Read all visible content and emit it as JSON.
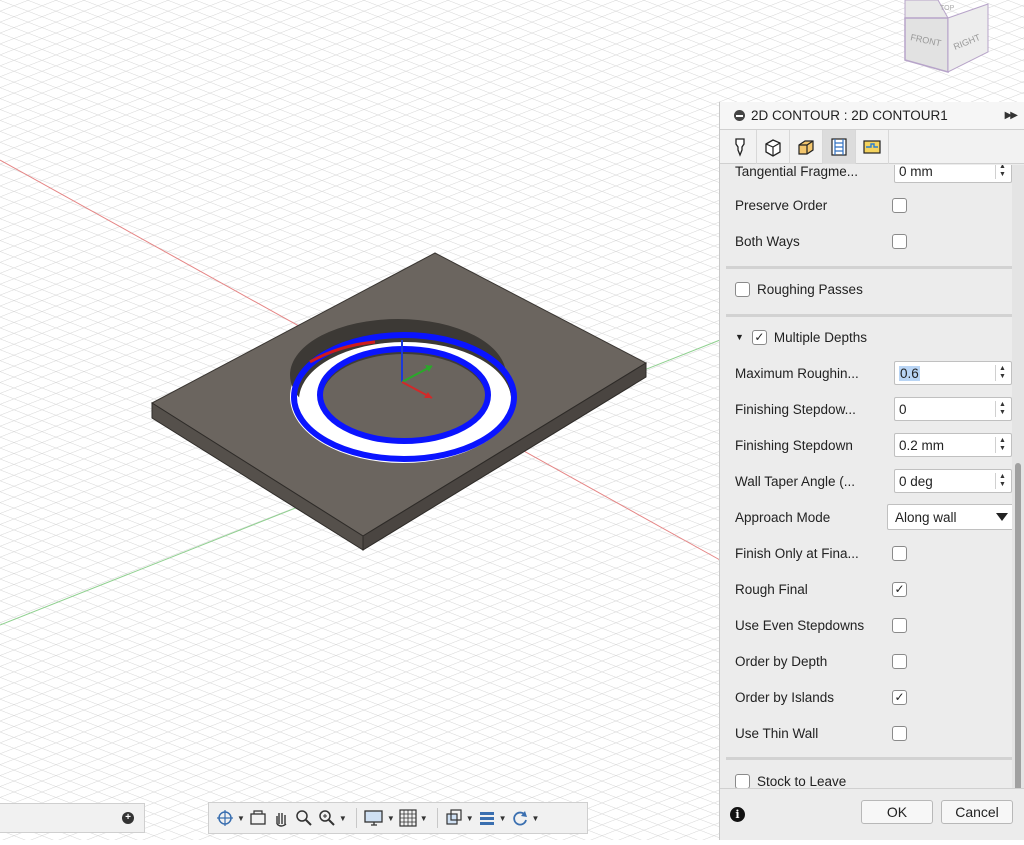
{
  "panel": {
    "title": "2D CONTOUR : 2D CONTOUR1",
    "expand_glyph": "▶▶",
    "tabs": [
      {
        "icon": "tool-icon"
      },
      {
        "icon": "geometry-icon"
      },
      {
        "icon": "heights-icon"
      },
      {
        "icon": "passes-icon",
        "active": true
      },
      {
        "icon": "linking-icon"
      }
    ],
    "fields": {
      "tangential_fragment": {
        "label": "Tangential Fragme...",
        "value": "0 mm"
      },
      "preserve_order": {
        "label": "Preserve Order",
        "checked": false
      },
      "both_ways": {
        "label": "Both Ways",
        "checked": false
      },
      "roughing_passes": {
        "label": "Roughing Passes",
        "checked": false
      },
      "multiple_depths": {
        "label": "Multiple Depths",
        "checked": true,
        "expanded": true
      },
      "max_roughing": {
        "label": "Maximum Roughin...",
        "value": "0.6"
      },
      "finishing_stepdowns_count": {
        "label": "Finishing Stepdow...",
        "value": "0"
      },
      "finishing_stepdown": {
        "label": "Finishing Stepdown",
        "value": "0.2 mm"
      },
      "wall_taper_angle": {
        "label": "Wall Taper Angle (...",
        "value": "0 deg"
      },
      "approach_mode": {
        "label": "Approach Mode",
        "value": "Along wall"
      },
      "finish_only_final": {
        "label": "Finish Only at Fina...",
        "checked": false
      },
      "rough_final": {
        "label": "Rough Final",
        "checked": true
      },
      "use_even_stepdowns": {
        "label": "Use Even Stepdowns",
        "checked": false
      },
      "order_by_depth": {
        "label": "Order by Depth",
        "checked": false
      },
      "order_by_islands": {
        "label": "Order by Islands",
        "checked": true
      },
      "use_thin_wall": {
        "label": "Use Thin Wall",
        "checked": false
      },
      "stock_to_leave": {
        "label": "Stock to Leave",
        "checked": false
      }
    },
    "ok_label": "OK",
    "cancel_label": "Cancel",
    "check_glyph": "✓"
  },
  "viewcube": {
    "top_label": "TOP",
    "front_label": "FRONT",
    "right_label": "RIGHT"
  },
  "colors": {
    "toolpath": "#0a14ff",
    "plate": "#6b655f",
    "grid": "#d9d9d9",
    "x_axis": "#e26a6a",
    "y_axis": "#7ac77a"
  },
  "toolbar": {
    "items": [
      "orbit-icon",
      "look-at-icon",
      "pan-icon",
      "zoom-icon",
      "fit-icon",
      "display-icon",
      "grid-icon",
      "viewports-icon",
      "layers-icon",
      "refresh-icon"
    ]
  }
}
